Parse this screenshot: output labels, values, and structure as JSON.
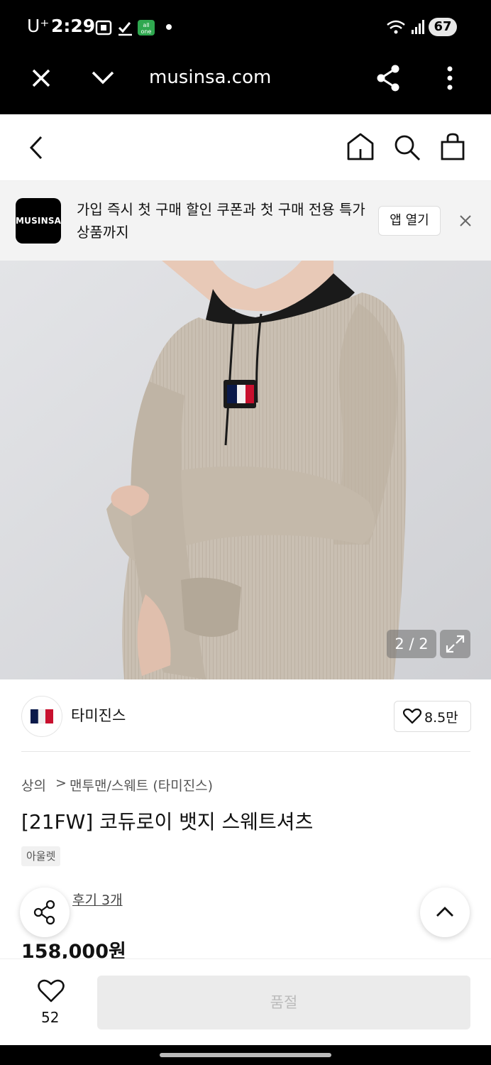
{
  "status_bar": {
    "carrier": "U⁺",
    "time": "2:29",
    "battery": "67"
  },
  "browser_bar": {
    "url": "musinsa.com"
  },
  "banner": {
    "logo_text": "MUSINSA",
    "message": "가입 즉시 첫 구매 할인 쿠폰과 첫 구매 전용 특가 상품까지",
    "open_app_label": "앱 열기"
  },
  "gallery": {
    "counter": "2 / 2"
  },
  "brand": {
    "name": "타미진스",
    "likes": "8.5만"
  },
  "category": {
    "level1": "상의",
    "separator": ">",
    "level2": "맨투맨/스웨트 (타미진스)"
  },
  "product": {
    "title": "[21FW] 코듀로이 뱃지 스웨트셔츠",
    "tag": "아울렛",
    "review_link": "후기 3개",
    "price": "158,000원"
  },
  "bottom_bar": {
    "wish_count": "52",
    "buy_label": "품절"
  },
  "colors": {
    "brand_red": "#c8102e",
    "brand_navy": "#0b1a4a"
  }
}
